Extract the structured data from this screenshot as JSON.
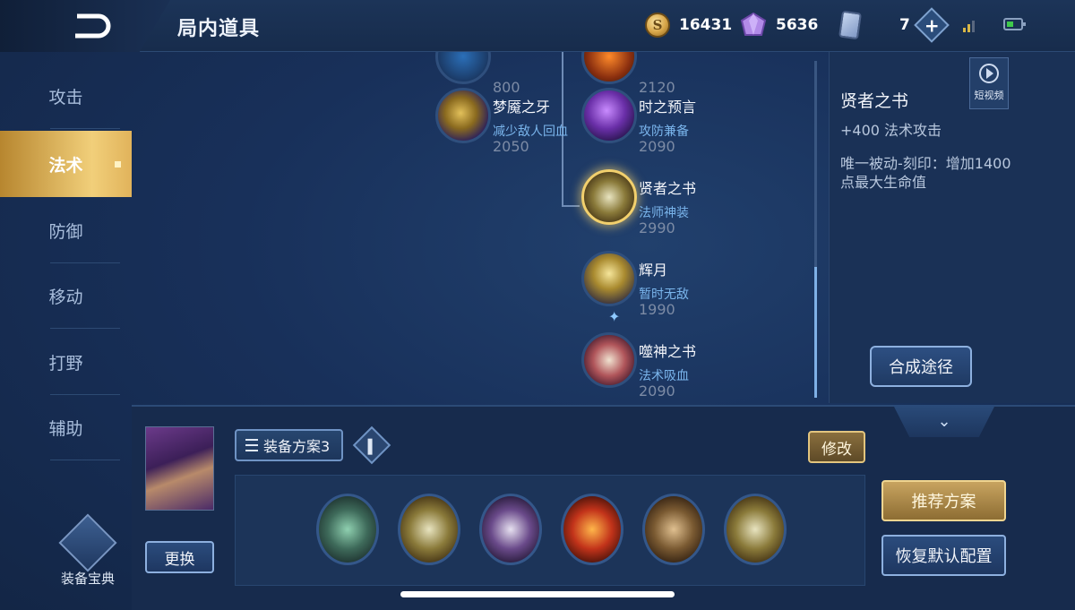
{
  "header": {
    "title": "局内道具",
    "gold": "16431",
    "gems": "5636",
    "tickets": "7",
    "colors": {
      "bg": "#1b2f52",
      "gold_accent": "#f1cf7a",
      "highlight_blue": "#7ab5ec"
    }
  },
  "sidebar": {
    "items": [
      {
        "label": "攻击"
      },
      {
        "label": "法术",
        "active": true
      },
      {
        "label": "防御"
      },
      {
        "label": "移动"
      },
      {
        "label": "打野"
      },
      {
        "label": "辅助"
      }
    ],
    "codex_label": "装备宝典"
  },
  "tree": {
    "items": [
      {
        "name": "",
        "desc": "",
        "price": "800",
        "icon": "blue-staff-icon"
      },
      {
        "name": "",
        "desc": "",
        "price": "2120",
        "icon": "orange-orb-icon"
      },
      {
        "name": "梦魇之牙",
        "desc": "减少敌人回血",
        "price": "2050",
        "icon": "nightmare-fang-icon"
      },
      {
        "name": "时之预言",
        "desc": "攻防兼备",
        "price": "2090",
        "icon": "prophecy-icon"
      },
      {
        "name": "贤者之书",
        "desc": "法师神装",
        "price": "2990",
        "icon": "sage-book-icon",
        "selected": true
      },
      {
        "name": "辉月",
        "desc": "暂时无敌",
        "price": "1990",
        "icon": "moon-staff-icon"
      },
      {
        "name": "噬神之书",
        "desc": "法术吸血",
        "price": "2090",
        "icon": "godeater-book-icon"
      }
    ]
  },
  "detail": {
    "title": "贤者之书",
    "stat": "+400 法术攻击",
    "passive": "唯一被动-刻印：增加1400点最大生命值",
    "video_label": "短视频",
    "compose_label": "合成途径"
  },
  "bottom": {
    "plan_label": "装备方案3",
    "edit_label": "修改",
    "swap_label": "更换",
    "recommend_label": "推荐方案",
    "reset_label": "恢复默认配置",
    "equipment": [
      {
        "icon": "boots-icon"
      },
      {
        "icon": "sage-book-icon"
      },
      {
        "icon": "skull-mask-icon"
      },
      {
        "icon": "fire-eye-orb-icon"
      },
      {
        "icon": "rune-shield-icon"
      },
      {
        "icon": "sage-book-icon"
      }
    ]
  }
}
